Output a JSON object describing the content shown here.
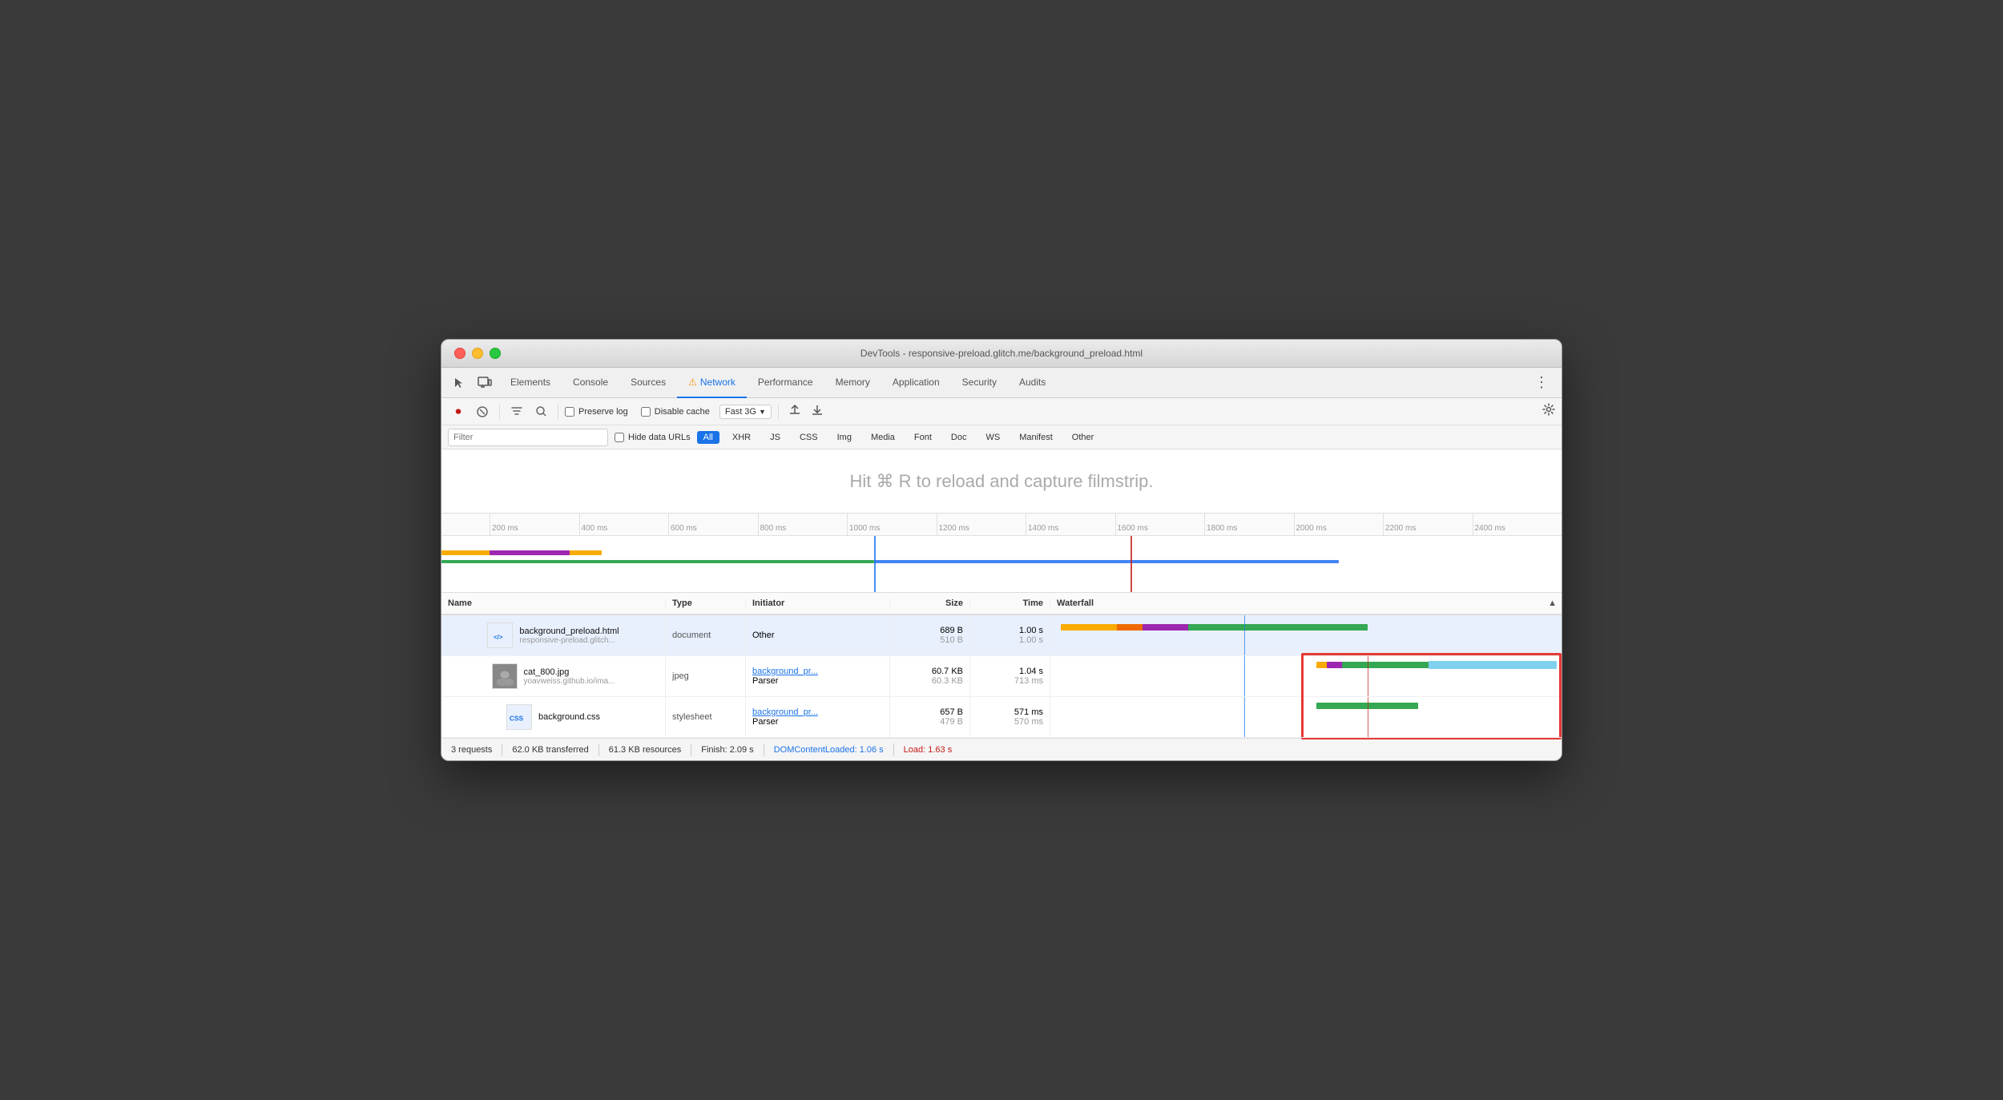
{
  "window": {
    "title": "DevTools - responsive-preload.glitch.me/background_preload.html"
  },
  "tabs": {
    "items": [
      {
        "label": "Elements",
        "active": false
      },
      {
        "label": "Console",
        "active": false
      },
      {
        "label": "Sources",
        "active": false
      },
      {
        "label": "Network",
        "active": true
      },
      {
        "label": "Performance",
        "active": false
      },
      {
        "label": "Memory",
        "active": false
      },
      {
        "label": "Application",
        "active": false
      },
      {
        "label": "Security",
        "active": false
      },
      {
        "label": "Audits",
        "active": false
      }
    ]
  },
  "toolbar": {
    "preserve_log": "Preserve log",
    "disable_cache": "Disable cache",
    "throttle": "Fast 3G"
  },
  "filter": {
    "placeholder": "Filter",
    "hide_data_urls": "Hide data URLs",
    "types": [
      "All",
      "XHR",
      "JS",
      "CSS",
      "Img",
      "Media",
      "Font",
      "Doc",
      "WS",
      "Manifest",
      "Other"
    ]
  },
  "filmstrip": {
    "hint": "Hit ⌘ R to reload and capture filmstrip."
  },
  "ruler": {
    "marks": [
      "200 ms",
      "400 ms",
      "600 ms",
      "800 ms",
      "1000 ms",
      "1200 ms",
      "1400 ms",
      "1600 ms",
      "1800 ms",
      "2000 ms",
      "2200 ms",
      "2400 ms"
    ]
  },
  "table": {
    "headers": {
      "name": "Name",
      "type": "Type",
      "initiator": "Initiator",
      "size": "Size",
      "time": "Time",
      "waterfall": "Waterfall"
    },
    "rows": [
      {
        "name": "background_preload.html",
        "name_secondary": "responsive-preload.glitch...",
        "type": "document",
        "initiator": "Other",
        "initiator_link": false,
        "size_1": "689 B",
        "size_2": "510 B",
        "time_1": "1.00 s",
        "time_2": "1.00 s",
        "icon_type": "html",
        "icon_label": "</>",
        "selected": true
      },
      {
        "name": "cat_800.jpg",
        "name_secondary": "yoavweiss.github.io/ima...",
        "type": "jpeg",
        "initiator": "background_pr...",
        "initiator2": "Parser",
        "initiator_link": true,
        "size_1": "60.7 KB",
        "size_2": "60.3 KB",
        "time_1": "1.04 s",
        "time_2": "713 ms",
        "icon_type": "jpg",
        "icon_label": "🖼",
        "selected": false
      },
      {
        "name": "background.css",
        "name_secondary": "",
        "type": "stylesheet",
        "initiator": "background_pr...",
        "initiator2": "Parser",
        "initiator_link": true,
        "size_1": "657 B",
        "size_2": "479 B",
        "time_1": "571 ms",
        "time_2": "570 ms",
        "icon_type": "css",
        "icon_label": "CSS",
        "selected": false
      }
    ]
  },
  "statusbar": {
    "requests": "3 requests",
    "transferred": "62.0 KB transferred",
    "resources": "61.3 KB resources",
    "finish": "Finish: 2.09 s",
    "dom_content": "DOMContentLoaded: 1.06 s",
    "load": "Load: 1.63 s"
  }
}
